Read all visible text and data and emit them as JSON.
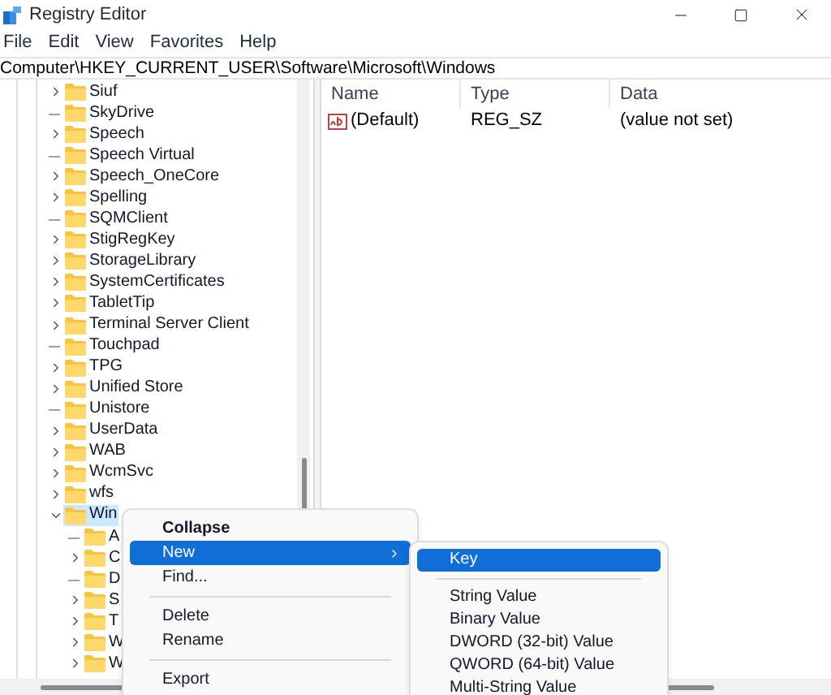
{
  "window": {
    "title": "Registry Editor"
  },
  "menu_bar": [
    "File",
    "Edit",
    "View",
    "Favorites",
    "Help"
  ],
  "address_bar": "Computer\\HKEY_CURRENT_USER\\Software\\Microsoft\\Windows",
  "tree": {
    "items": [
      {
        "label": "Siuf",
        "expandable": true,
        "selected": false
      },
      {
        "label": "SkyDrive",
        "expandable": false,
        "selected": false
      },
      {
        "label": "Speech",
        "expandable": true,
        "selected": false
      },
      {
        "label": "Speech Virtual",
        "expandable": false,
        "selected": false
      },
      {
        "label": "Speech_OneCore",
        "expandable": true,
        "selected": false
      },
      {
        "label": "Spelling",
        "expandable": true,
        "selected": false
      },
      {
        "label": "SQMClient",
        "expandable": false,
        "selected": false
      },
      {
        "label": "StigRegKey",
        "expandable": true,
        "selected": false
      },
      {
        "label": "StorageLibrary",
        "expandable": true,
        "selected": false
      },
      {
        "label": "SystemCertificates",
        "expandable": true,
        "selected": false
      },
      {
        "label": "TabletTip",
        "expandable": true,
        "selected": false
      },
      {
        "label": "Terminal Server Client",
        "expandable": true,
        "selected": false
      },
      {
        "label": "Touchpad",
        "expandable": false,
        "selected": false
      },
      {
        "label": "TPG",
        "expandable": true,
        "selected": false
      },
      {
        "label": "Unified Store",
        "expandable": true,
        "selected": false
      },
      {
        "label": "Unistore",
        "expandable": false,
        "selected": false
      },
      {
        "label": "UserData",
        "expandable": true,
        "selected": false
      },
      {
        "label": "WAB",
        "expandable": true,
        "selected": false
      },
      {
        "label": "WcmSvc",
        "expandable": true,
        "selected": false
      },
      {
        "label": "wfs",
        "expandable": true,
        "selected": false
      },
      {
        "label": "Win",
        "expandable": true,
        "selected": true,
        "children": [
          {
            "label": "A",
            "expandable": false,
            "selected": false
          },
          {
            "label": "C",
            "expandable": true,
            "selected": false
          },
          {
            "label": "D",
            "expandable": false,
            "selected": false
          },
          {
            "label": "S",
            "expandable": true,
            "selected": false
          },
          {
            "label": "T",
            "expandable": true,
            "selected": false
          },
          {
            "label": "W",
            "expandable": true,
            "selected": false
          },
          {
            "label": "W",
            "expandable": true,
            "selected": false
          }
        ]
      }
    ]
  },
  "values_list": {
    "columns": [
      "Name",
      "Type",
      "Data"
    ],
    "rows": [
      {
        "name": "(Default)",
        "type": "REG_SZ",
        "data": "(value not set)"
      }
    ]
  },
  "context_menu": {
    "items": [
      {
        "kind": "item",
        "label": "Collapse",
        "default": true,
        "selected": false,
        "submenu": false
      },
      {
        "kind": "item",
        "label": "New",
        "default": false,
        "selected": true,
        "submenu": true
      },
      {
        "kind": "item",
        "label": "Find...",
        "default": false,
        "selected": false,
        "submenu": false
      },
      {
        "kind": "separator"
      },
      {
        "kind": "item",
        "label": "Delete",
        "default": false,
        "selected": false,
        "submenu": false
      },
      {
        "kind": "item",
        "label": "Rename",
        "default": false,
        "selected": false,
        "submenu": false
      },
      {
        "kind": "separator"
      },
      {
        "kind": "item",
        "label": "Export",
        "default": false,
        "selected": false,
        "submenu": false
      }
    ]
  },
  "submenu": {
    "items": [
      {
        "kind": "item",
        "label": "Key",
        "selected": true
      },
      {
        "kind": "separator"
      },
      {
        "kind": "item",
        "label": "String Value",
        "selected": false
      },
      {
        "kind": "item",
        "label": "Binary Value",
        "selected": false
      },
      {
        "kind": "item",
        "label": "DWORD (32-bit) Value",
        "selected": false
      },
      {
        "kind": "item",
        "label": "QWORD (64-bit) Value",
        "selected": false
      },
      {
        "kind": "item",
        "label": "Multi-String Value",
        "selected": false
      }
    ]
  }
}
